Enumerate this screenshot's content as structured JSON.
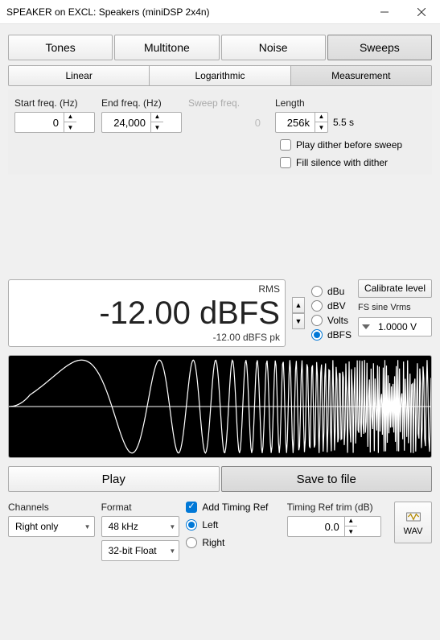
{
  "window": {
    "title": "SPEAKER on EXCL: Speakers (miniDSP 2x4n)"
  },
  "tabs_main": {
    "tones": "Tones",
    "multitone": "Multitone",
    "noise": "Noise",
    "sweeps": "Sweeps"
  },
  "subtabs": {
    "linear": "Linear",
    "logarithmic": "Logarithmic",
    "measurement": "Measurement"
  },
  "sweep": {
    "start_label": "Start freq. (Hz)",
    "start_value": "0",
    "end_label": "End freq. (Hz)",
    "end_value": "24,000",
    "sweepfreq_label": "Sweep freq.",
    "sweepfreq_value": "0",
    "length_label": "Length",
    "length_value": "256k",
    "length_secs": "5.5 s",
    "dither_before": "Play dither before sweep",
    "fill_silence": "Fill silence with dither"
  },
  "level": {
    "rms_tag": "RMS",
    "value": "-12.00 dBFS",
    "peak": "-12.00 dBFS pk",
    "units": {
      "dbu": "dBu",
      "dbv": "dBV",
      "volts": "Volts",
      "dbfs": "dBFS"
    },
    "calibrate_btn": "Calibrate level",
    "fs_label": "FS sine Vrms",
    "fs_value": "1.0000 V"
  },
  "actions": {
    "play": "Play",
    "save": "Save to file"
  },
  "bottom": {
    "channels_label": "Channels",
    "channels_value": "Right only",
    "format_label": "Format",
    "samplerate_value": "48 kHz",
    "bitdepth_value": "32-bit Float",
    "add_timing": "Add Timing Ref",
    "timing_left": "Left",
    "timing_right": "Right",
    "trim_label": "Timing Ref trim (dB)",
    "trim_value": "0.0",
    "wav": "WAV"
  }
}
